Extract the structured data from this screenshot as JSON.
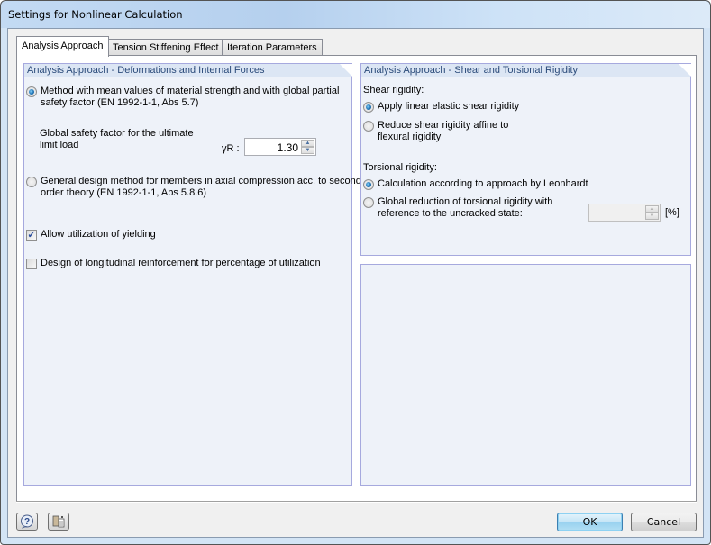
{
  "window": {
    "title": "Settings for Nonlinear Calculation"
  },
  "tabs": [
    {
      "label": "Analysis Approach",
      "active": true
    },
    {
      "label": "Tension Stiffening Effect",
      "active": false
    },
    {
      "label": "Iteration Parameters",
      "active": false
    }
  ],
  "left_panel": {
    "header": "Analysis Approach - Deformations and Internal Forces",
    "option_mean_values": {
      "line1": "Method with mean values of material strength and with global partial",
      "line2": "safety factor (EN 1992-1-1, Abs 5.7)",
      "checked": true
    },
    "safety_factor": {
      "label_line1": "Global safety factor for the ultimate",
      "label_line2": "limit load",
      "symbol": "γR :",
      "value": "1.30"
    },
    "option_general_design": {
      "line1": "General design method for members in axial compression acc. to second",
      "line2": "order theory (EN 1992-1-1, Abs 5.8.6)",
      "checked": false
    },
    "allow_yielding": {
      "label": "Allow utilization of yielding",
      "checked": true
    },
    "design_longitudinal": {
      "label": "Design of longitudinal reinforcement for percentage of utilization",
      "checked": false
    }
  },
  "right_panel": {
    "header": "Analysis Approach - Shear and Torsional Rigidity",
    "shear_label": "Shear rigidity:",
    "shear_linear": {
      "label": "Apply linear elastic shear rigidity",
      "checked": true
    },
    "shear_reduce": {
      "line1": "Reduce shear rigidity affine to",
      "line2": "flexural rigidity",
      "checked": false
    },
    "torsional_label": "Torsional rigidity:",
    "torsional_leonhardt": {
      "label": "Calculation according to approach by Leonhardt",
      "checked": true
    },
    "torsional_global": {
      "line1": "Global reduction of torsional rigidity with",
      "line2": "reference to the uncracked state:",
      "checked": false,
      "value": "",
      "unit": "[%]"
    }
  },
  "footer": {
    "help_icon": "help-icon",
    "details_icon": "details-icon",
    "ok_label": "OK",
    "cancel_label": "Cancel"
  }
}
